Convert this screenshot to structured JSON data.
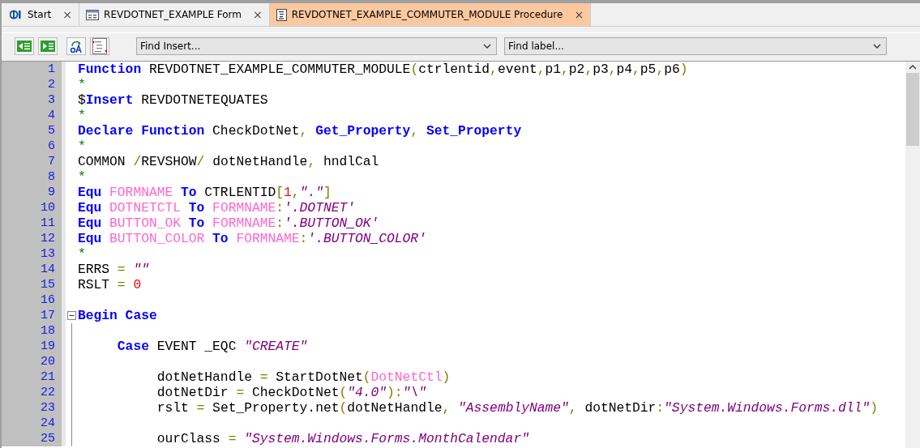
{
  "tabs": [
    {
      "label": "Start",
      "close": "×",
      "selected": false
    },
    {
      "label": "REVDOTNET_EXAMPLE Form",
      "close": "×",
      "selected": false
    },
    {
      "label": "REVDOTNET_EXAMPLE_COMMUTER_MODULE Procedure",
      "close": "×",
      "selected": true
    }
  ],
  "toolbar": {
    "find_insert": "Find Insert...",
    "find_label": "Find label..."
  },
  "editor": {
    "lines": [
      {
        "number": "1",
        "tokens": [
          {
            "kind": "keyword",
            "text": "Function"
          },
          {
            "kind": "plain",
            "text": " REVDOTNET_EXAMPLE_COMMUTER_MODULE"
          },
          {
            "kind": "punct",
            "text": "("
          },
          {
            "kind": "plain",
            "text": "ctrlentid"
          },
          {
            "kind": "punct",
            "text": ","
          },
          {
            "kind": "plain",
            "text": "event"
          },
          {
            "kind": "punct",
            "text": ","
          },
          {
            "kind": "plain",
            "text": "p1"
          },
          {
            "kind": "punct",
            "text": ","
          },
          {
            "kind": "plain",
            "text": "p2"
          },
          {
            "kind": "punct",
            "text": ","
          },
          {
            "kind": "plain",
            "text": "p3"
          },
          {
            "kind": "punct",
            "text": ","
          },
          {
            "kind": "plain",
            "text": "p4"
          },
          {
            "kind": "punct",
            "text": ","
          },
          {
            "kind": "plain",
            "text": "p5"
          },
          {
            "kind": "punct",
            "text": ","
          },
          {
            "kind": "plain",
            "text": "p6"
          },
          {
            "kind": "punct",
            "text": ")"
          }
        ]
      },
      {
        "number": "2",
        "tokens": [
          {
            "kind": "comment",
            "text": "*"
          }
        ]
      },
      {
        "number": "3",
        "tokens": [
          {
            "kind": "plain",
            "text": "$"
          },
          {
            "kind": "keyword",
            "text": "Insert"
          },
          {
            "kind": "plain",
            "text": " REVDOTNETEQUATES"
          }
        ]
      },
      {
        "number": "4",
        "tokens": [
          {
            "kind": "comment",
            "text": "*"
          }
        ]
      },
      {
        "number": "5",
        "tokens": [
          {
            "kind": "keyword",
            "text": "Declare Function"
          },
          {
            "kind": "plain",
            "text": " CheckDotNet"
          },
          {
            "kind": "punct",
            "text": ", "
          },
          {
            "kind": "keyword",
            "text": "Get_Property"
          },
          {
            "kind": "punct",
            "text": ", "
          },
          {
            "kind": "keyword",
            "text": "Set_Property"
          }
        ]
      },
      {
        "number": "6",
        "tokens": [
          {
            "kind": "comment",
            "text": "*"
          }
        ]
      },
      {
        "number": "7",
        "tokens": [
          {
            "kind": "plain",
            "text": "COMMON "
          },
          {
            "kind": "punct",
            "text": "/"
          },
          {
            "kind": "plain",
            "text": "REVSHOW"
          },
          {
            "kind": "punct",
            "text": "/"
          },
          {
            "kind": "plain",
            "text": " dotNetHandle"
          },
          {
            "kind": "punct",
            "text": ", "
          },
          {
            "kind": "plain",
            "text": "hndlCal"
          }
        ]
      },
      {
        "number": "8",
        "tokens": [
          {
            "kind": "comment",
            "text": "*"
          }
        ]
      },
      {
        "number": "9",
        "tokens": [
          {
            "kind": "keyword",
            "text": "Equ"
          },
          {
            "kind": "equate",
            "text": " FORMNAME"
          },
          {
            "kind": "keyword",
            "text": " To"
          },
          {
            "kind": "plain",
            "text": " CTRLENTID"
          },
          {
            "kind": "punct",
            "text": "["
          },
          {
            "kind": "number",
            "text": "1"
          },
          {
            "kind": "punct",
            "text": ","
          },
          {
            "kind": "string",
            "text": "\".\""
          },
          {
            "kind": "punct",
            "text": "]"
          }
        ]
      },
      {
        "number": "10",
        "tokens": [
          {
            "kind": "keyword",
            "text": "Equ"
          },
          {
            "kind": "equate",
            "text": " DOTNETCTL"
          },
          {
            "kind": "keyword",
            "text": " To"
          },
          {
            "kind": "equate",
            "text": " FORMNAME"
          },
          {
            "kind": "punct",
            "text": ":"
          },
          {
            "kind": "string",
            "text": "'.DOTNET'"
          }
        ]
      },
      {
        "number": "11",
        "tokens": [
          {
            "kind": "keyword",
            "text": "Equ"
          },
          {
            "kind": "equate",
            "text": " BUTTON_OK"
          },
          {
            "kind": "keyword",
            "text": " To"
          },
          {
            "kind": "equate",
            "text": " FORMNAME"
          },
          {
            "kind": "punct",
            "text": ":"
          },
          {
            "kind": "string",
            "text": "'.BUTTON_OK'"
          }
        ]
      },
      {
        "number": "12",
        "tokens": [
          {
            "kind": "keyword",
            "text": "Equ"
          },
          {
            "kind": "equate",
            "text": " BUTTON_COLOR"
          },
          {
            "kind": "keyword",
            "text": " To"
          },
          {
            "kind": "equate",
            "text": " FORMNAME"
          },
          {
            "kind": "punct",
            "text": ":"
          },
          {
            "kind": "string",
            "text": "'.BUTTON_COLOR'"
          }
        ]
      },
      {
        "number": "13",
        "tokens": [
          {
            "kind": "comment",
            "text": "*"
          }
        ]
      },
      {
        "number": "14",
        "tokens": [
          {
            "kind": "plain",
            "text": "ERRS "
          },
          {
            "kind": "punct",
            "text": "= "
          },
          {
            "kind": "string",
            "text": "\"\""
          }
        ]
      },
      {
        "number": "15",
        "tokens": [
          {
            "kind": "plain",
            "text": "RSLT "
          },
          {
            "kind": "punct",
            "text": "= "
          },
          {
            "kind": "number",
            "text": "0"
          }
        ]
      },
      {
        "number": "16"
      },
      {
        "number": "17",
        "fold": {
          "expanded": true
        },
        "tokens": [
          {
            "kind": "keyword",
            "text": "Begin Case"
          }
        ]
      },
      {
        "number": "18"
      },
      {
        "number": "19",
        "tokens": [
          {
            "kind": "keyword",
            "text": "     Case"
          },
          {
            "kind": "plain",
            "text": " EVENT _EQC "
          },
          {
            "kind": "string",
            "text": "\"CREATE\""
          }
        ]
      },
      {
        "number": "20"
      },
      {
        "number": "21",
        "tokens": [
          {
            "kind": "plain",
            "text": "          dotNetHandle "
          },
          {
            "kind": "punct",
            "text": "="
          },
          {
            "kind": "plain",
            "text": " StartDotNet"
          },
          {
            "kind": "punct",
            "text": "("
          },
          {
            "kind": "equate",
            "text": "DotNetCtl"
          },
          {
            "kind": "punct",
            "text": ")"
          }
        ]
      },
      {
        "number": "22",
        "tokens": [
          {
            "kind": "plain",
            "text": "          dotNetDir "
          },
          {
            "kind": "punct",
            "text": "="
          },
          {
            "kind": "plain",
            "text": " CheckDotNet"
          },
          {
            "kind": "punct",
            "text": "("
          },
          {
            "kind": "string",
            "text": "\"4.0\""
          },
          {
            "kind": "punct",
            "text": "):"
          },
          {
            "kind": "string",
            "text": "\"\\\""
          }
        ]
      },
      {
        "number": "23",
        "tokens": [
          {
            "kind": "plain",
            "text": "          rslt "
          },
          {
            "kind": "punct",
            "text": "="
          },
          {
            "kind": "plain",
            "text": " Set_Property.net"
          },
          {
            "kind": "punct",
            "text": "("
          },
          {
            "kind": "plain",
            "text": "dotNetHandle"
          },
          {
            "kind": "punct",
            "text": ", "
          },
          {
            "kind": "string",
            "text": "\"AssemblyName\""
          },
          {
            "kind": "punct",
            "text": ", "
          },
          {
            "kind": "plain",
            "text": "dotNetDir"
          },
          {
            "kind": "punct",
            "text": ":"
          },
          {
            "kind": "string",
            "text": "\"System.Windows.Forms.dll\""
          },
          {
            "kind": "punct",
            "text": ")"
          }
        ]
      },
      {
        "number": "24"
      },
      {
        "number": "25",
        "tokens": [
          {
            "kind": "plain",
            "text": "          ourClass "
          },
          {
            "kind": "punct",
            "text": "= "
          },
          {
            "kind": "string",
            "text": "\"System.Windows.Forms.MonthCalendar\""
          }
        ]
      }
    ]
  }
}
